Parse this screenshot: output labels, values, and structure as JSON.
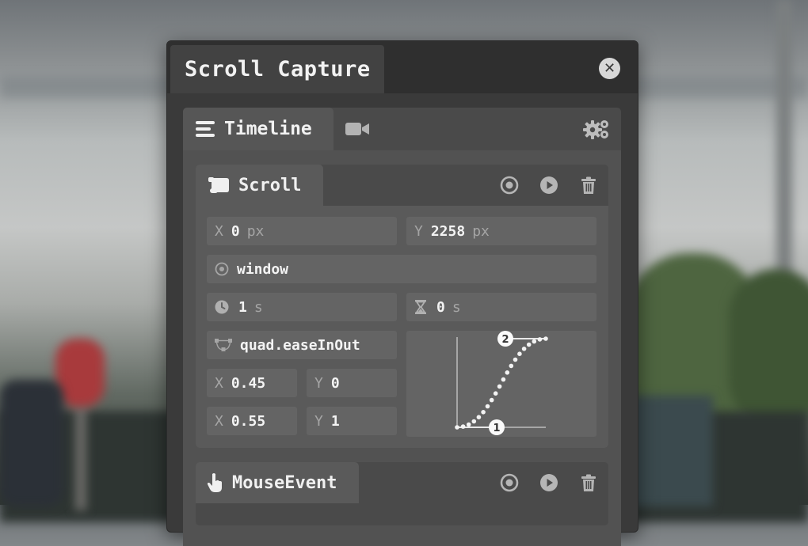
{
  "panel": {
    "title": "Scroll Capture"
  },
  "tabs": {
    "timeline_label": "Timeline"
  },
  "scroll_card": {
    "title": "Scroll",
    "x": {
      "label": "X",
      "value": "0",
      "unit": "px"
    },
    "y": {
      "label": "Y",
      "value": "2258",
      "unit": "px"
    },
    "target": "window",
    "duration": {
      "value": "1",
      "unit": "s"
    },
    "delay": {
      "value": "0",
      "unit": "s"
    },
    "easing": "quad.easeInOut",
    "cp1": {
      "x_label": "X",
      "x": "0.45",
      "y_label": "Y",
      "y": "0"
    },
    "cp2": {
      "x_label": "X",
      "x": "0.55",
      "y_label": "Y",
      "y": "1"
    },
    "graph_markers": [
      "1",
      "2"
    ]
  },
  "mouse_card": {
    "title": "MouseEvent"
  },
  "icons": {
    "close": "close-icon",
    "timeline": "list-icon",
    "video": "video-camera-icon",
    "settings": "gears-icon",
    "scroll": "scroll-icon",
    "target": "target-icon",
    "play": "play-icon",
    "trash": "trash-icon",
    "clock": "clock-icon",
    "hourglass": "hourglass-icon",
    "bezier": "bezier-curve-icon",
    "pointer": "hand-pointer-icon"
  }
}
